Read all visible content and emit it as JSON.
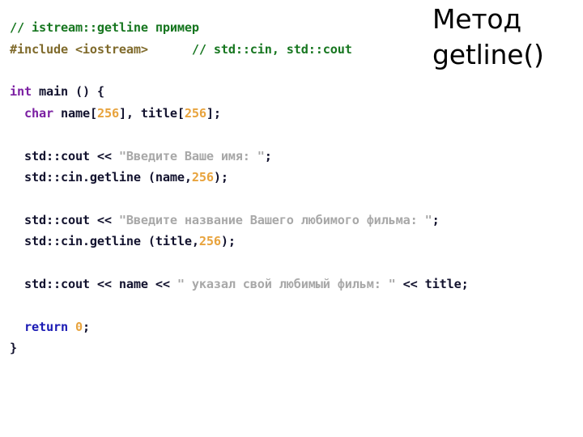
{
  "slide": {
    "title": "Метод getline()",
    "background_color": "#ffffff"
  },
  "colors": {
    "comment": "#16761f",
    "preprocessor": "#7f6a2b",
    "keyword": "#7b1fa2",
    "return_keyword": "#1a1ab4",
    "number": "#e8a33d",
    "string": "#a8a8a8",
    "plain": "#12122e",
    "title": "#000000"
  },
  "code": {
    "language": "cpp",
    "plain_text": "// istream::getline пример\n#include <iostream>      // std::cin, std::cout\n\nint main () {\n  char name[256], title[256];\n\n  std::cout << \"Введите Ваше имя: \";\n  std::cin.getline (name,256);\n\n  std::cout << \"Введите название Вашего любимого фильма: \";\n  std::cin.getline (title,256);\n\n  std::cout << name << \" указал свой любимый фильм: \" << title;\n\n  return 0;\n}",
    "lines": [
      {
        "index": 1,
        "tokens": [
          {
            "t": "// istream::getline пример",
            "c": "comment"
          }
        ]
      },
      {
        "index": 2,
        "tokens": [
          {
            "t": "#include <iostream>",
            "c": "preprocessor"
          },
          {
            "t": "      ",
            "c": "plain"
          },
          {
            "t": "// std::cin, std::cout",
            "c": "comment"
          }
        ]
      },
      {
        "index": 3,
        "tokens": []
      },
      {
        "index": 4,
        "tokens": [
          {
            "t": "int",
            "c": "keyword"
          },
          {
            "t": " main () {",
            "c": "plain"
          }
        ]
      },
      {
        "index": 5,
        "tokens": [
          {
            "t": "  ",
            "c": "plain"
          },
          {
            "t": "char",
            "c": "keyword"
          },
          {
            "t": " name[",
            "c": "plain"
          },
          {
            "t": "256",
            "c": "number"
          },
          {
            "t": "], title[",
            "c": "plain"
          },
          {
            "t": "256",
            "c": "number"
          },
          {
            "t": "];",
            "c": "plain"
          }
        ]
      },
      {
        "index": 6,
        "tokens": []
      },
      {
        "index": 7,
        "tokens": [
          {
            "t": "  std::cout << ",
            "c": "plain"
          },
          {
            "t": "\"Введите Ваше имя: \"",
            "c": "string"
          },
          {
            "t": ";",
            "c": "plain"
          }
        ]
      },
      {
        "index": 8,
        "tokens": [
          {
            "t": "  std::cin.getline (name,",
            "c": "plain"
          },
          {
            "t": "256",
            "c": "number"
          },
          {
            "t": ");",
            "c": "plain"
          }
        ]
      },
      {
        "index": 9,
        "tokens": []
      },
      {
        "index": 10,
        "tokens": [
          {
            "t": "  std::cout << ",
            "c": "plain"
          },
          {
            "t": "\"Введите название Вашего любимого фильма: \"",
            "c": "string"
          },
          {
            "t": ";",
            "c": "plain"
          }
        ]
      },
      {
        "index": 11,
        "tokens": [
          {
            "t": "  std::cin.getline (title,",
            "c": "plain"
          },
          {
            "t": "256",
            "c": "number"
          },
          {
            "t": ");",
            "c": "plain"
          }
        ]
      },
      {
        "index": 12,
        "tokens": []
      },
      {
        "index": 13,
        "tokens": [
          {
            "t": "  std::cout << name << ",
            "c": "plain"
          },
          {
            "t": "\" указал свой любимый фильм: \"",
            "c": "string"
          },
          {
            "t": " << title;",
            "c": "plain"
          }
        ]
      },
      {
        "index": 14,
        "tokens": []
      },
      {
        "index": 15,
        "tokens": [
          {
            "t": "  ",
            "c": "plain"
          },
          {
            "t": "return",
            "c": "return_keyword"
          },
          {
            "t": " ",
            "c": "plain"
          },
          {
            "t": "0",
            "c": "number"
          },
          {
            "t": ";",
            "c": "plain"
          }
        ]
      },
      {
        "index": 16,
        "tokens": [
          {
            "t": "}",
            "c": "plain"
          }
        ]
      }
    ]
  }
}
